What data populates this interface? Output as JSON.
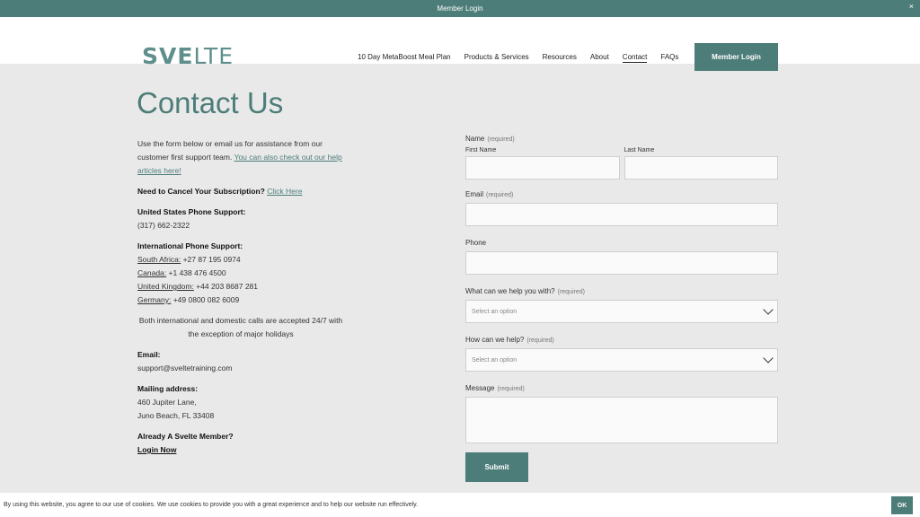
{
  "topbar": {
    "text": "Member Login",
    "close": "×"
  },
  "header": {
    "logo_a": "SVE",
    "logo_b": "LTE",
    "nav": [
      "10 Day MetaBoost Meal Plan",
      "Products & Services",
      "Resources",
      "About",
      "Contact",
      "FAQs"
    ],
    "member_button": "Member Login"
  },
  "page": {
    "title": "Contact Us"
  },
  "left": {
    "intro": "Use the form below or email us for assistance from our customer first support team.",
    "intro_link": "You can also check out our help articles here!",
    "cancel_label": "Need to Cancel Your Subscription?",
    "cancel_link": "Click Here",
    "us_label": "United States Phone Support:",
    "us_phone": "(317) 662-2322",
    "intl_label": "International Phone Support:",
    "intl": [
      {
        "country": "South Africa:",
        "phone": "+27 87 195 0974"
      },
      {
        "country": "Canada:",
        "phone": "+1 438 476 4500"
      },
      {
        "country": "United Kingdom:",
        "phone": "+44 203 8687 281"
      },
      {
        "country": "Germany:",
        "phone": "+49 0800 082 6009"
      }
    ],
    "calls_note": "Both international and domestic calls are accepted 24/7 with the exception of major holidays",
    "email_label": "Email:",
    "email": "support@sveltetraining.com",
    "mail_label": "Mailing address:",
    "mail_line1": "460 Jupiter Lane,",
    "mail_line2": "Juno Beach, FL 33408",
    "member_label": "Already A Svelte Member?",
    "member_link": "Login Now"
  },
  "form": {
    "name_label": "Name",
    "required": "(required)",
    "first_name": "First Name",
    "last_name": "Last Name",
    "email_label": "Email",
    "phone_label": "Phone",
    "help_with_label": "What can we help you with?",
    "help_with_placeholder": "Select an option",
    "how_help_label": "How can we help?",
    "how_help_placeholder": "Select an option",
    "message_label": "Message",
    "submit": "Submit"
  },
  "cookie": {
    "text": "By using this website, you agree to our use of cookies. We use cookies to provide you with a great experience and to help our website run effectively.",
    "ok": "OK"
  },
  "colors": {
    "accent": "#4d7d79",
    "background": "#e9e9e9"
  }
}
